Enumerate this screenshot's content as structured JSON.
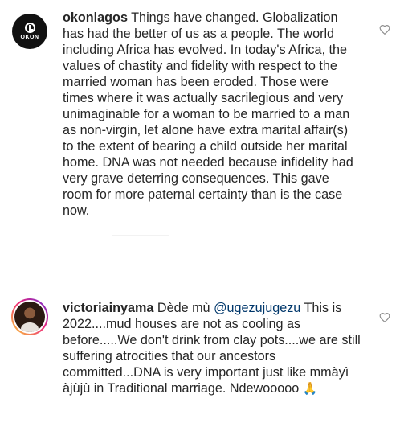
{
  "comments": [
    {
      "username": "okonlagos",
      "avatar_label": "OKON",
      "text": "Things have changed. Globalization has had the better of us as a people. The world including Africa has evolved. In today's Africa, the values of chastity and fidelity with respect to the married woman has been eroded. Those were times where it was actually sacrilegious and very unimaginable for a woman to be married to a man as non-virgin, let alone have extra marital affair(s) to the extent of bearing a child outside her marital home. DNA was not needed because infidelity had very grave deterring consequences. This gave room for more paternal certainty than is the case now.",
      "like_icon": "heart-outline-icon"
    },
    {
      "username": "victoriainyama",
      "text_prefix": "Dède mù",
      "mention": "@ugezujugezu",
      "text": "This is 2022....mud houses are not as cooling as before.....We don't drink from clay pots....we are still suffering atrocities that our ancestors committed...DNA is very important just like mmàyì àjùjù in Traditional marriage. Ndewooooo",
      "emoji": "🙏",
      "like_icon": "heart-outline-icon"
    }
  ],
  "colors": {
    "text": "#262626",
    "mention": "#00376b",
    "icon": "#8e8e8e",
    "background": "#ffffff"
  }
}
